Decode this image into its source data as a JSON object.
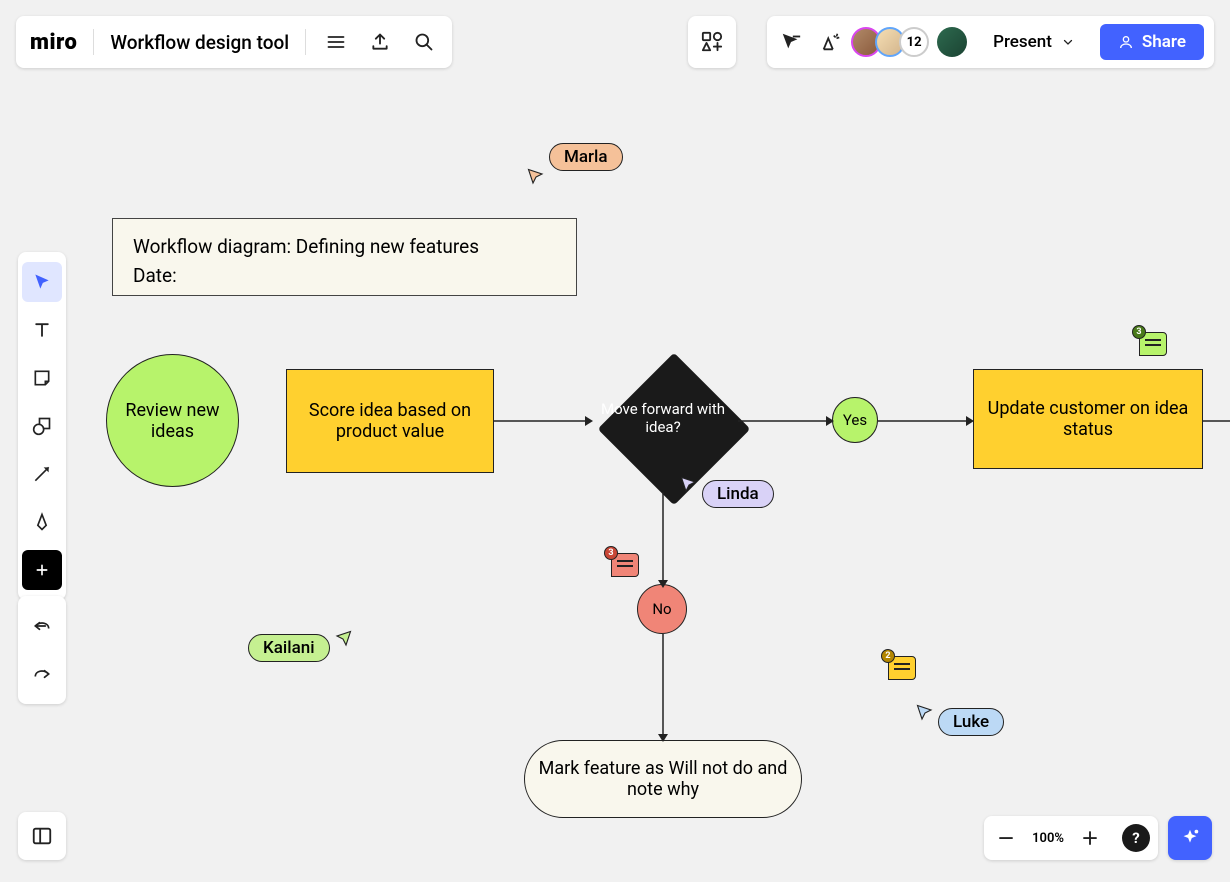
{
  "app": {
    "logo": "miro",
    "board_title": "Workflow design tool"
  },
  "header": {
    "present_label": "Present",
    "share_label": "Share",
    "user_count": "12"
  },
  "zoom": {
    "level": "100%",
    "help": "?"
  },
  "diagram": {
    "note_line1": "Workflow diagram: Defining new features",
    "note_line2": "Date:",
    "nodes": {
      "review": "Review new ideas",
      "score": "Score idea based on product value",
      "decide": "Move forward with idea?",
      "yes": "Yes",
      "no": "No",
      "update": "Update customer on idea status",
      "wontdo": "Mark feature as Will not do and note why"
    }
  },
  "cursors": {
    "marla": "Marla",
    "linda": "Linda",
    "kailani": "Kailani",
    "luke": "Luke"
  },
  "comments": {
    "c1": "3",
    "c2": "3",
    "c3": "2"
  }
}
